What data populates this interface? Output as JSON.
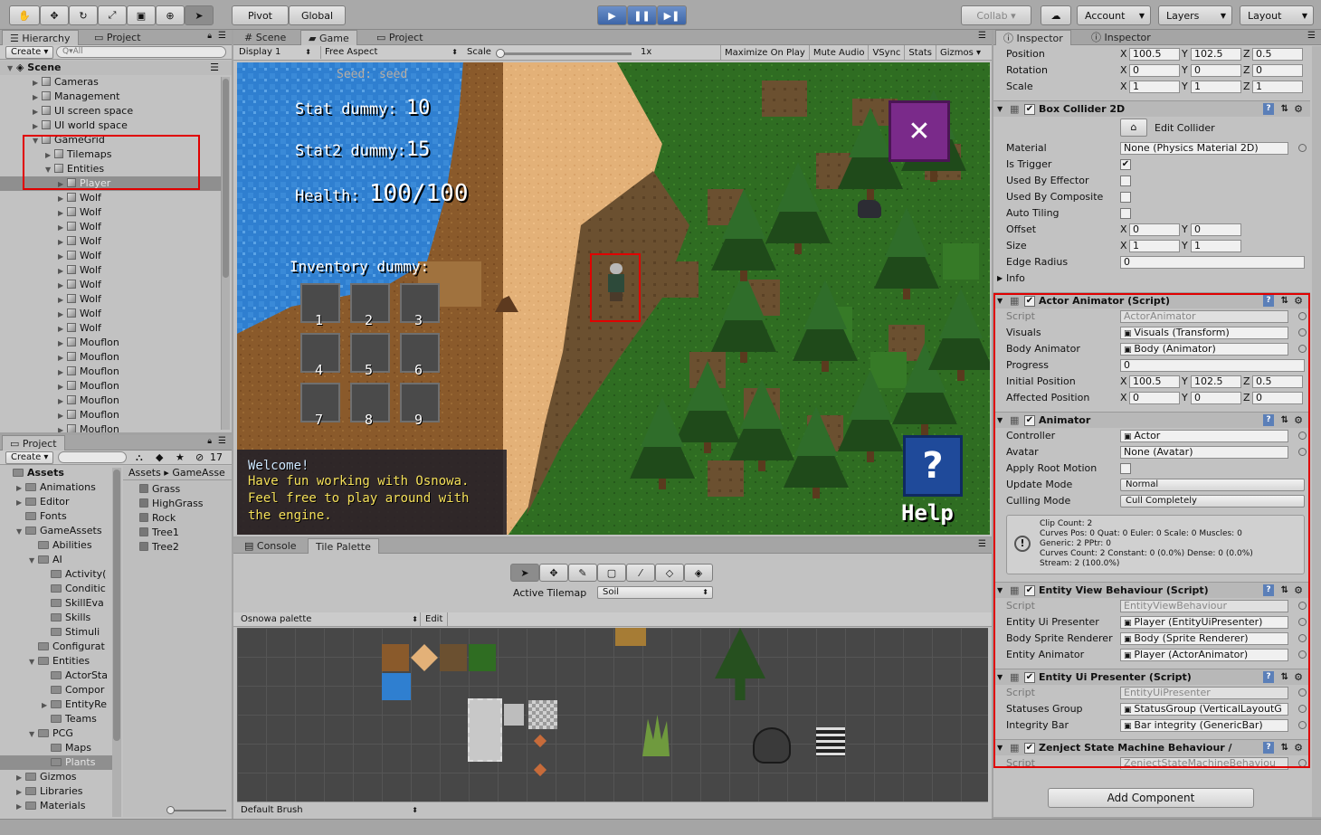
{
  "toolbar": {
    "pivot": "Pivot",
    "global": "Global",
    "collab": "Collab ▾",
    "account": "Account",
    "layers": "Layers",
    "layout": "Layout"
  },
  "hierarchy": {
    "tab": "Hierarchy",
    "tab2": "Project",
    "create": "Create ▾",
    "search": "Q▾All",
    "scene": "Scene",
    "items": [
      "Cameras",
      "Management",
      "UI screen space",
      "UI world space",
      "GameGrid",
      "Tilemaps",
      "Entities",
      "Player",
      "Wolf",
      "Wolf",
      "Wolf",
      "Wolf",
      "Wolf",
      "Wolf",
      "Wolf",
      "Wolf",
      "Wolf",
      "Wolf",
      "Mouflon",
      "Mouflon",
      "Mouflon",
      "Mouflon",
      "Mouflon",
      "Mouflon",
      "Mouflon"
    ]
  },
  "project": {
    "tab": "Project",
    "create": "Create ▾",
    "count": "17",
    "breadcrumb": "Assets ▸ GameAsse",
    "tree": [
      "Assets",
      "Animations",
      "Editor",
      "Fonts",
      "GameAssets",
      "Abilities",
      "AI",
      "Activity(",
      "Conditic",
      "SkillEva",
      "Skills",
      "Stimuli",
      "Configurat",
      "Entities",
      "ActorSta",
      "Compor",
      "EntityRe",
      "Teams",
      "PCG",
      "Maps",
      "Plants",
      "Gizmos",
      "Libraries",
      "Materials"
    ],
    "files": [
      "Grass",
      "HighGrass",
      "Rock",
      "Tree1",
      "Tree2"
    ]
  },
  "game": {
    "tabs": [
      "# Scene",
      "Game",
      "Project"
    ],
    "display": "Display 1",
    "aspect": "Free Aspect",
    "scale_label": "Scale",
    "scale_value": "1x",
    "toggles": [
      "Maximize On Play",
      "Mute Audio",
      "VSync",
      "Stats",
      "Gizmos ▾"
    ],
    "seed": "Seed: seed",
    "stat1_label": "Stat dummy:",
    "stat1": "10",
    "stat2_label": "Stat2 dummy:",
    "stat2": "15",
    "health_label": "Health:",
    "health": "100/100",
    "inventory": "Inventory dummy:",
    "slots": [
      "1",
      "2",
      "3",
      "4",
      "5",
      "6",
      "7",
      "8",
      "9"
    ],
    "welcome_title": "Welcome!",
    "welcome_lines": [
      "Have fun working with Osnowa.",
      "Feel free to play around with",
      "the engine."
    ],
    "help": "Help",
    "close_glyph": "✕",
    "help_glyph": "?"
  },
  "palette": {
    "tabs": [
      "Console",
      "Tile Palette"
    ],
    "active_tilemap_label": "Active Tilemap",
    "active_tilemap": "Soil",
    "palette_name": "Osnowa palette",
    "edit": "Edit",
    "brush": "Default Brush"
  },
  "inspector": {
    "tabs": [
      "Inspector",
      "Inspector"
    ],
    "transform": [
      {
        "label": "Position",
        "x": "100.5",
        "y": "102.5",
        "z": "0.5"
      },
      {
        "label": "Rotation",
        "x": "0",
        "y": "0",
        "z": "0"
      },
      {
        "label": "Scale",
        "x": "1",
        "y": "1",
        "z": "1"
      }
    ],
    "box": {
      "title": "Box Collider 2D",
      "edit": "Edit Collider",
      "material_label": "Material",
      "material": "None (Physics Material 2D)",
      "is_trigger": "Is Trigger",
      "used_by_effector": "Used By Effector",
      "used_by_composite": "Used By Composite",
      "auto_tiling": "Auto Tiling",
      "offset": "Offset",
      "offset_x": "0",
      "offset_y": "0",
      "size": "Size",
      "size_x": "1",
      "size_y": "1",
      "edge_radius": "Edge Radius",
      "edge_value": "0",
      "info": "Info"
    },
    "actor": {
      "title": "Actor Animator (Script)",
      "script_label": "Script",
      "script": "ActorAnimator",
      "visuals_label": "Visuals",
      "visuals": "Visuals (Transform)",
      "body_label": "Body Animator",
      "body": "Body (Animator)",
      "progress_label": "Progress",
      "progress": "0",
      "init_label": "Initial Position",
      "init_x": "100.5",
      "init_y": "102.5",
      "init_z": "0.5",
      "aff_label": "Affected Position",
      "aff_x": "0",
      "aff_y": "0",
      "aff_z": "0"
    },
    "animator": {
      "title": "Animator",
      "controller_label": "Controller",
      "controller": "Actor",
      "avatar_label": "Avatar",
      "avatar": "None (Avatar)",
      "root_label": "Apply Root Motion",
      "update_label": "Update Mode",
      "update": "Normal",
      "culling_label": "Culling Mode",
      "culling": "Cull Completely",
      "info": [
        "Clip Count: 2",
        "Curves Pos: 0 Quat: 0 Euler: 0 Scale: 0 Muscles: 0",
        "Generic: 2 PPtr: 0",
        "Curves Count: 2 Constant: 0 (0.0%) Dense: 0 (0.0%)",
        "Stream: 2 (100.0%)"
      ]
    },
    "view": {
      "title": "Entity View Behaviour (Script)",
      "script_label": "Script",
      "script": "EntityViewBehaviour",
      "ui_label": "Entity Ui Presenter",
      "ui": "Player (EntityUiPresenter)",
      "sprite_label": "Body Sprite Renderer",
      "sprite": "Body (Sprite Renderer)",
      "anim_label": "Entity Animator",
      "anim": "Player (ActorAnimator)"
    },
    "presenter": {
      "title": "Entity Ui Presenter (Script)",
      "script_label": "Script",
      "script": "EntityUiPresenter",
      "status_label": "Statuses Group",
      "status": "StatusGroup (VerticalLayoutG",
      "bar_label": "Integrity Bar",
      "bar": "Bar integrity (GenericBar)"
    },
    "zenject": {
      "title": "Zenject State Machine Behaviour /",
      "script_label": "Script",
      "script": "ZenjectStateMachineBehaviou"
    },
    "add_component": "Add Component"
  }
}
